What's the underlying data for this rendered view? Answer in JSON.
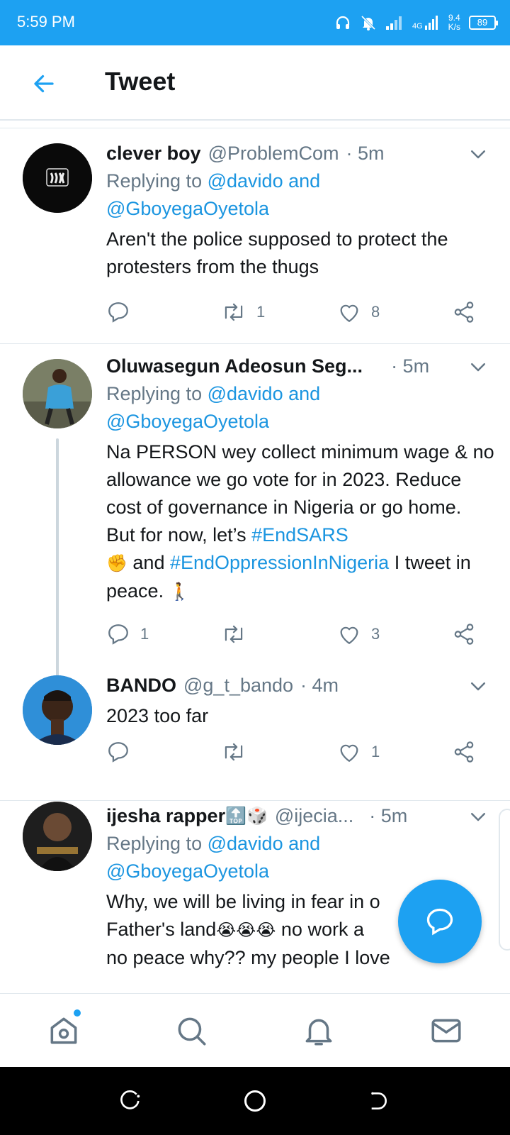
{
  "status_bar": {
    "time": "5:59 PM",
    "network": "4G",
    "speed_value": "9.4",
    "speed_unit": "K/s",
    "battery": "89"
  },
  "header": {
    "title": "Tweet"
  },
  "tweets": [
    {
      "name": "clever boy",
      "handle": "@ProblemCom",
      "time": "· 5m",
      "replying_prefix": "Replying to",
      "replying_to_1": "@davido and",
      "replying_to_2": "@GboyegaOyetola",
      "text": "Aren't the police supposed to protect the protesters from the thugs",
      "replies": "",
      "retweets": "1",
      "likes": "8"
    },
    {
      "name": "Oluwasegun Adeosun Seg...",
      "handle": "",
      "time": "· 5m",
      "replying_prefix": "Replying to",
      "replying_to_1": "@davido and",
      "replying_to_2": "@GboyegaOyetola",
      "text_part1": "Na PERSON wey collect minimum wage & no allowance we go vote for in 2023. Reduce cost of governance in Nigeria or go home. But for now, let’s",
      "hashtag_1": "#EndSARS",
      "text_part2": "and",
      "hashtag_2": "#EndOppressionInNigeria",
      "text_part3": "I tweet in peace.",
      "emoji_fist": "✊",
      "emoji_walk": "🚶",
      "replies": "1",
      "retweets": "",
      "likes": "3"
    },
    {
      "name": "BANDO",
      "handle": "@g_t_bando",
      "time": "· 4m",
      "text": "2023 too far",
      "replies": "",
      "retweets": "",
      "likes": "1"
    },
    {
      "name": "ijesha rapper",
      "name_emoji": "🔝🎲",
      "handle": "@ijecia...",
      "time": "· 5m",
      "replying_prefix": "Replying to",
      "replying_to_1": "@davido and",
      "replying_to_2": "@GboyegaOyetola",
      "text_line1": "Why, we will be living in fear in o",
      "text_line2a": "Father's land",
      "emoji_cry": "😭😭😭",
      "text_line2b": "no work a",
      "text_line3": "no peace why?? my people I love"
    }
  ],
  "icons": {
    "back": "arrow-left-icon",
    "caret": "chevron-down-icon",
    "reply": "reply-icon",
    "retweet": "retweet-icon",
    "like": "heart-icon",
    "share": "share-icon",
    "compose": "compose-reply-icon",
    "home": "home-icon",
    "search": "search-icon",
    "notifications": "bell-icon",
    "messages": "mail-icon"
  },
  "colors": {
    "brand": "#1da1f2",
    "link": "#1b95e0",
    "secondary_text": "#657786",
    "divider": "#e1e8ed"
  }
}
